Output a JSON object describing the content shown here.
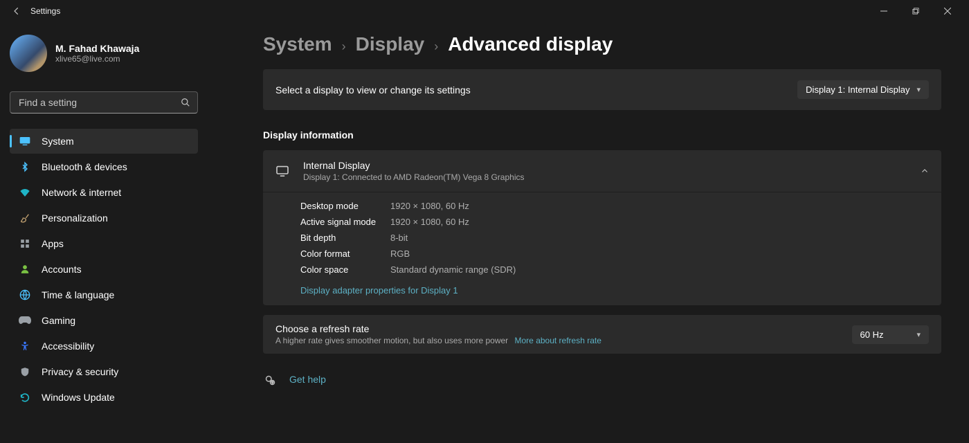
{
  "titlebar": {
    "app_title": "Settings"
  },
  "profile": {
    "name": "M. Fahad Khawaja",
    "email": "xlive65@live.com"
  },
  "search": {
    "placeholder": "Find a setting"
  },
  "sidebar": {
    "items": [
      {
        "label": "System"
      },
      {
        "label": "Bluetooth & devices"
      },
      {
        "label": "Network & internet"
      },
      {
        "label": "Personalization"
      },
      {
        "label": "Apps"
      },
      {
        "label": "Accounts"
      },
      {
        "label": "Time & language"
      },
      {
        "label": "Gaming"
      },
      {
        "label": "Accessibility"
      },
      {
        "label": "Privacy & security"
      },
      {
        "label": "Windows Update"
      }
    ]
  },
  "breadcrumb": {
    "crumb1": "System",
    "crumb2": "Display",
    "current": "Advanced display"
  },
  "selector": {
    "label": "Select a display to view or change its settings",
    "value": "Display 1: Internal Display"
  },
  "display_info": {
    "section_label": "Display information",
    "title": "Internal Display",
    "subtitle": "Display 1: Connected to AMD Radeon(TM) Vega 8 Graphics",
    "props": {
      "desktop_mode_k": "Desktop mode",
      "desktop_mode_v": "1920 × 1080, 60 Hz",
      "active_signal_k": "Active signal mode",
      "active_signal_v": "1920 × 1080, 60 Hz",
      "bit_depth_k": "Bit depth",
      "bit_depth_v": "8-bit",
      "color_format_k": "Color format",
      "color_format_v": "RGB",
      "color_space_k": "Color space",
      "color_space_v": "Standard dynamic range (SDR)"
    },
    "adapter_link": "Display adapter properties for Display 1"
  },
  "refresh": {
    "title": "Choose a refresh rate",
    "subtitle": "A higher rate gives smoother motion, but also uses more power",
    "more": "More about refresh rate",
    "value": "60 Hz"
  },
  "help": {
    "label": "Get help"
  }
}
